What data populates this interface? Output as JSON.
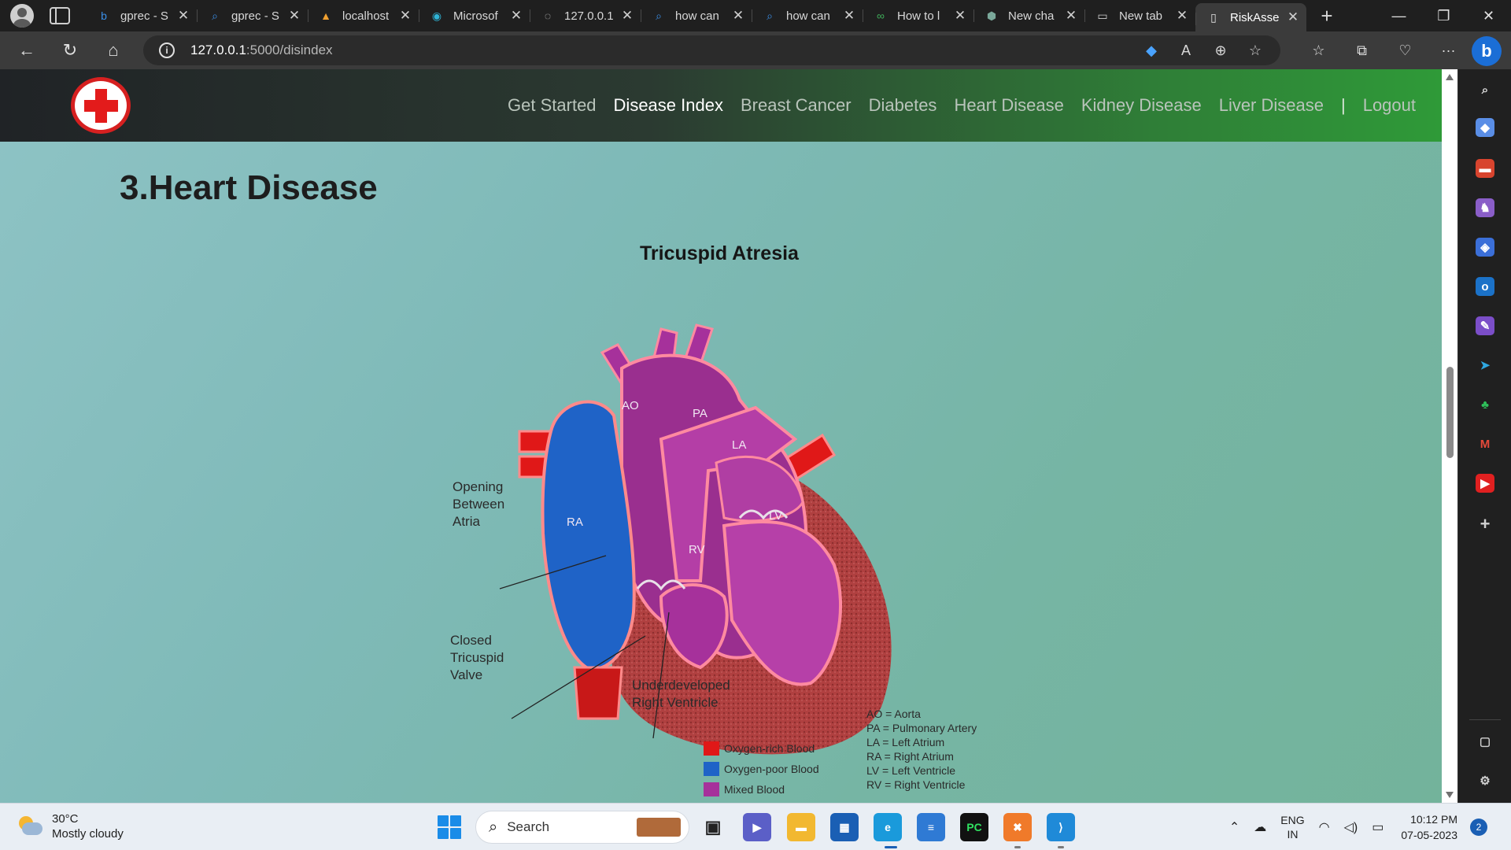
{
  "browser": {
    "tabs": [
      {
        "title": "gprec - S",
        "icon": "bing-icon",
        "active": false
      },
      {
        "title": "gprec - S",
        "icon": "search-icon",
        "active": false
      },
      {
        "title": "localhost",
        "icon": "alert-icon",
        "active": false
      },
      {
        "title": "Microsof",
        "icon": "edge-icon",
        "active": false
      },
      {
        "title": "127.0.0.1",
        "icon": "page-icon",
        "active": false
      },
      {
        "title": "how can",
        "icon": "search-icon",
        "active": false
      },
      {
        "title": "how can",
        "icon": "search-icon",
        "active": false
      },
      {
        "title": "How to l",
        "icon": "link-icon",
        "active": false
      },
      {
        "title": "New cha",
        "icon": "chatgpt-icon",
        "active": false
      },
      {
        "title": "New tab",
        "icon": "newtab-icon",
        "active": false
      },
      {
        "title": "RiskAsse",
        "icon": "document-icon",
        "active": true
      }
    ],
    "url_host": "127.0.0.1",
    "url_path": ":5000/disindex"
  },
  "site": {
    "nav": [
      {
        "label": "Get Started",
        "current": false
      },
      {
        "label": "Disease Index",
        "current": true
      },
      {
        "label": "Breast Cancer",
        "current": false
      },
      {
        "label": "Diabetes",
        "current": false
      },
      {
        "label": "Heart Disease",
        "current": false
      },
      {
        "label": "Kidney Disease",
        "current": false
      },
      {
        "label": "Liver Disease",
        "current": false
      }
    ],
    "separator": "|",
    "logout": "Logout",
    "section_title": "3.Heart Disease"
  },
  "diagram": {
    "title": "Tricuspid Atresia",
    "chambers": {
      "ao": "AO",
      "pa": "PA",
      "la": "LA",
      "ra": "RA",
      "lv": "LV",
      "rv": "RV"
    },
    "callouts": {
      "opening": [
        "Opening",
        "Between",
        "Atria"
      ],
      "closed": [
        "Closed",
        "Tricuspid",
        "Valve"
      ],
      "underdeveloped": [
        "Underdeveloped",
        "Right Ventricle"
      ]
    },
    "legend": [
      {
        "label": "Oxygen-rich Blood",
        "color": "#e01818"
      },
      {
        "label": "Oxygen-poor Blood",
        "color": "#1f63c7"
      },
      {
        "label": "Mixed Blood",
        "color": "#a6319b"
      }
    ],
    "abbreviations": [
      "AO = Aorta",
      "PA = Pulmonary Artery",
      "LA = Left Atrium",
      "RA = Right Atrium",
      "LV = Left Ventricle",
      "RV = Right Ventricle"
    ]
  },
  "taskbar": {
    "temperature": "30°C",
    "condition": "Mostly cloudy",
    "search_label": "Search",
    "lang_top": "ENG",
    "lang_bottom": "IN",
    "time": "10:12 PM",
    "date": "07-05-2023",
    "notification_count": "2"
  }
}
